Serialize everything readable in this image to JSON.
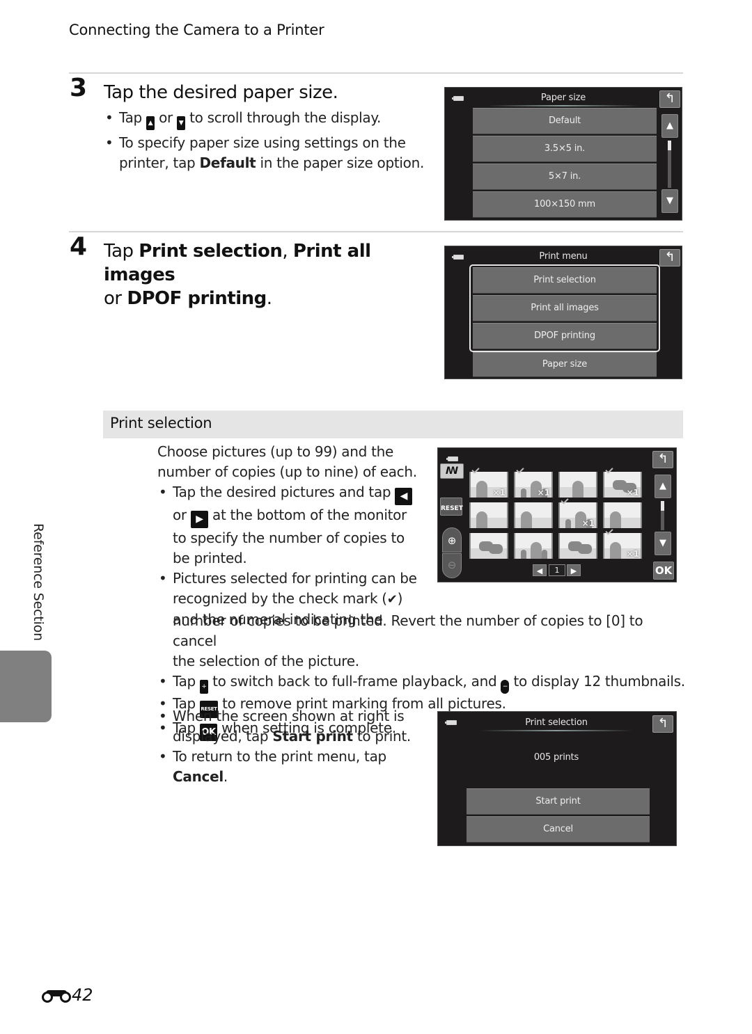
{
  "header": {
    "running_head": "Connecting the Camera to a Printer"
  },
  "step3": {
    "number": "3",
    "title": "Tap the desired paper size.",
    "bullets": {
      "b1_pre": "Tap",
      "b1_mid": "or",
      "b1_post": "to scroll through the display.",
      "b2_line1": "To specify paper size using settings on the",
      "b2_line2_pre": "printer, tap",
      "b2_bold": "Default",
      "b2_line2_post": "in the paper size option."
    },
    "screen": {
      "title": "Paper size",
      "options": [
        "Default",
        "3.5×5 in.",
        "5×7 in.",
        "100×150 mm"
      ],
      "scroll_position": 0.05
    }
  },
  "step4": {
    "number": "4",
    "title_pre": "Tap",
    "title_b1": "Print selection",
    "title_sep": ",",
    "title_b2": "Print all images",
    "title_or": "or",
    "title_b3": "DPOF printing",
    "title_end": ".",
    "screen": {
      "title": "Print menu",
      "options": [
        "Print selection",
        "Print all images",
        "DPOF printing",
        "Paper size"
      ]
    }
  },
  "print_selection": {
    "section_title": "Print selection",
    "intro_line1": "Choose pictures (up to 99) and the",
    "intro_line2": "number of copies (up to nine) of each.",
    "b1_l1_pre": "Tap the desired pictures and tap",
    "b1_l2_pre": "or",
    "b1_l2_post": "at the bottom of the monitor",
    "b1_l3": "to specify the number of copies to",
    "b1_l4": "be printed.",
    "b2_l1": "Pictures selected for printing can be",
    "b2_l2_pre": "recognized by the check mark (",
    "b2_l2_post": ")",
    "b2_l3": "and the numeral indicating the",
    "b2_l4": "number of copies to be printed. Revert the number of copies to [0] to cancel",
    "b2_l5": "the selection of the picture.",
    "b3_pre": "Tap",
    "b3_mid": "to switch back to full-frame playback, and",
    "b3_post": "to display 12 thumbnails.",
    "b4_pre": "Tap",
    "b4_post": "to remove print marking from all pictures.",
    "b5_pre": "Tap",
    "b5_post": "when setting is complete.",
    "b6_l1": "When the screen shown at right is",
    "b6_l2_pre": "displayed, tap",
    "b6_bold": "Start print",
    "b6_l2_post": "to print.",
    "b7_l1": "To return to the print menu, tap",
    "b7_bold": "Cancel",
    "b7_end": ".",
    "icons": {
      "reset_label": "RESET",
      "ok_label": "OK",
      "left_arrow": "◀",
      "right_arrow": "▶",
      "check": "✔",
      "zoom_in": "🔍",
      "up": "▲",
      "down": "▼"
    },
    "grid_screen": {
      "page": "1",
      "thumbnails": [
        {
          "selected": true,
          "count": "×1"
        },
        {
          "selected": true,
          "count": "×1"
        },
        {
          "selected": false,
          "count": ""
        },
        {
          "selected": true,
          "count": "×1"
        },
        {
          "selected": false,
          "count": ""
        },
        {
          "selected": false,
          "count": ""
        },
        {
          "selected": true,
          "count": "×1"
        },
        {
          "selected": false,
          "count": ""
        },
        {
          "selected": false,
          "count": ""
        },
        {
          "selected": false,
          "count": ""
        },
        {
          "selected": false,
          "count": ""
        },
        {
          "selected": true,
          "count": "×1"
        }
      ],
      "scroll_position": 0.1
    },
    "confirm_screen": {
      "title": "Print selection",
      "prints": "005  prints",
      "start_label": "Start print",
      "cancel_label": "Cancel"
    }
  },
  "sidebar": {
    "label": "Reference Section"
  },
  "footer": {
    "page_number": "42",
    "section_icon": "binoculars-icon"
  }
}
